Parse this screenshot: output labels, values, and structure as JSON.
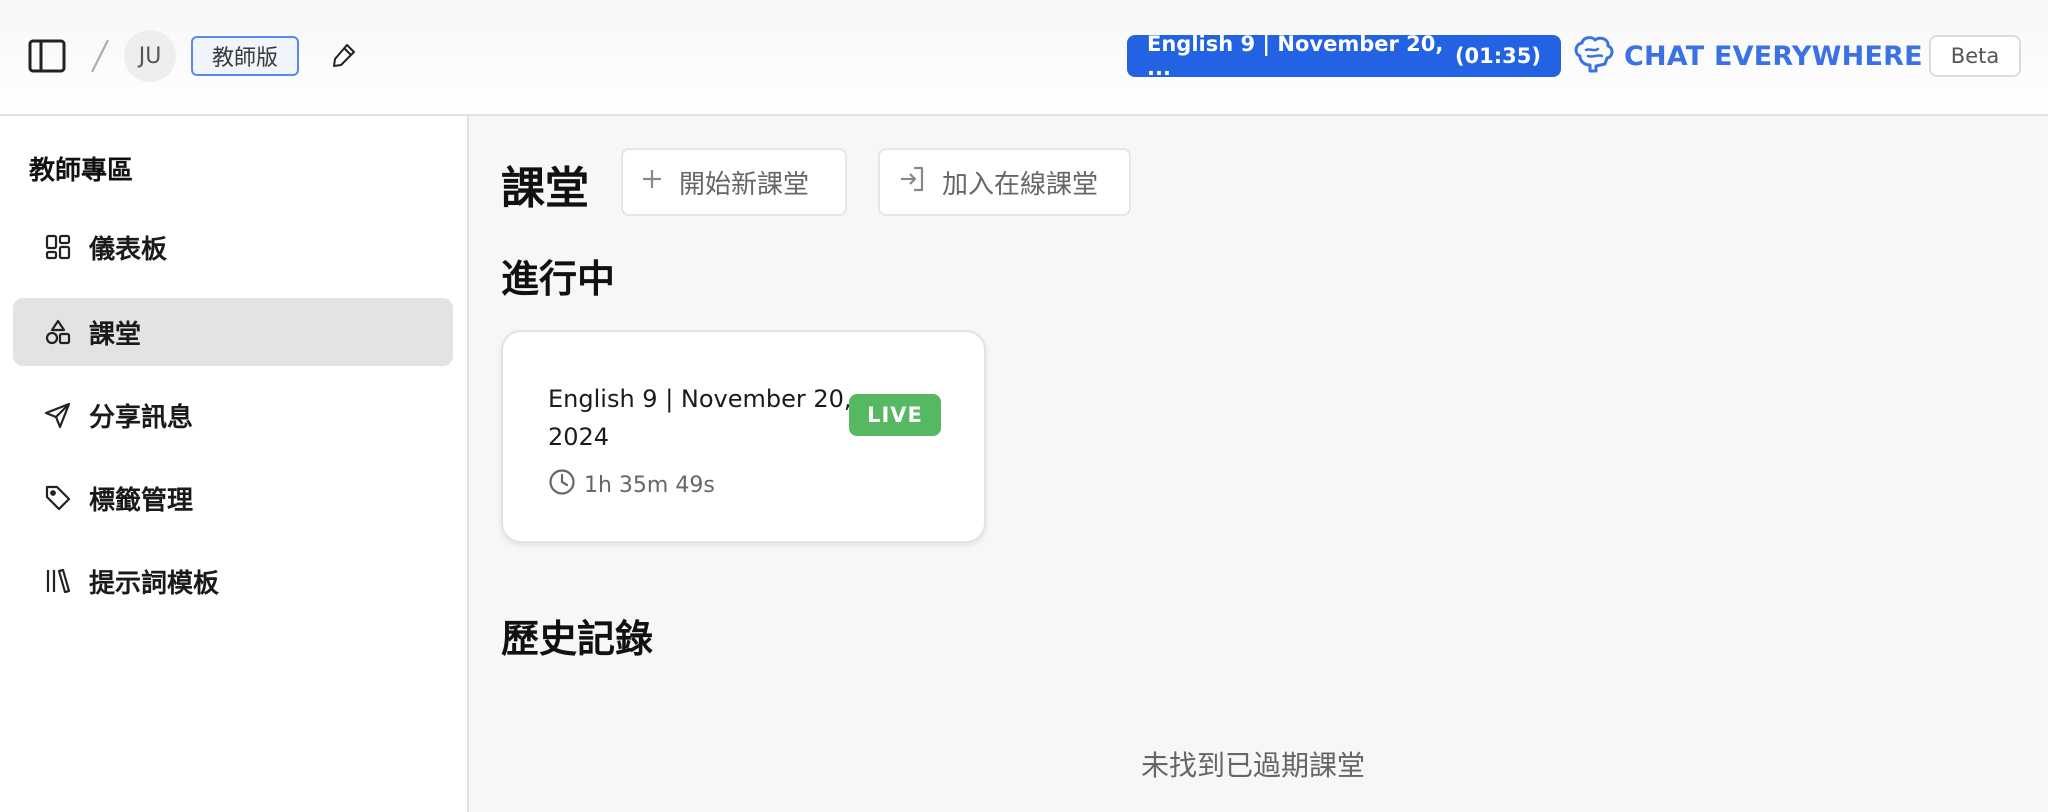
{
  "header": {
    "avatar_initials": "JU",
    "edition_badge": "教師版",
    "session": {
      "title": "English 9 | November 20, ...",
      "timer": "(01:35)"
    },
    "logo_text": "CHAT EVERYWHERE",
    "beta_label": "Beta",
    "icons": {
      "toggle": "sidebar-toggle-icon",
      "separator": "slash-separator-icon",
      "pen": "pen-icon",
      "logo": "brain-icon"
    },
    "accent_color": "#2262e3"
  },
  "sidebar": {
    "title": "教師專區",
    "items": [
      {
        "label": "儀表板",
        "icon": "dashboard-icon",
        "active": false
      },
      {
        "label": "課堂",
        "icon": "shapes-icon",
        "active": true
      },
      {
        "label": "分享訊息",
        "icon": "send-icon",
        "active": false
      },
      {
        "label": "標籤管理",
        "icon": "tag-icon",
        "active": false
      },
      {
        "label": "提示詞模板",
        "icon": "library-icon",
        "active": false
      }
    ]
  },
  "main": {
    "title": "課堂",
    "buttons": {
      "new_class": "開始新課堂",
      "join_class": "加入在線課堂"
    },
    "ongoing_heading": "進行中",
    "ongoing_card": {
      "title": "English 9 | November 20, 2024",
      "status": "LIVE",
      "duration": "1h 35m 49s",
      "status_color": "#57b862"
    },
    "history_heading": "歷史記錄",
    "empty_history": "未找到已過期課堂"
  }
}
